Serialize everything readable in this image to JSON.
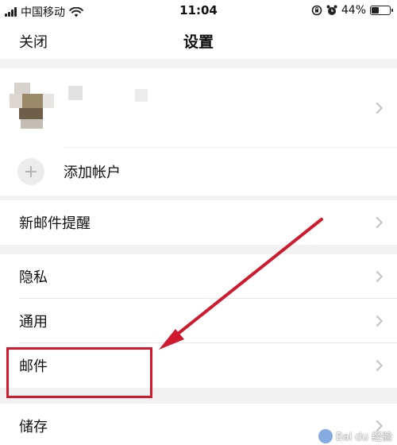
{
  "status_bar": {
    "carrier": "中国移动",
    "time": "11:04",
    "battery_text": "44%",
    "battery_level": 0.44,
    "icons": [
      "signal-icon",
      "wifi-icon",
      "rotation-lock-icon",
      "alarm-icon",
      "battery-icon"
    ]
  },
  "nav": {
    "close_label": "关闭",
    "title": "设置"
  },
  "account": {
    "add_account_label": "添加帐户"
  },
  "sections": {
    "notifications": {
      "new_mail_alert": "新邮件提醒"
    },
    "general": {
      "privacy": "隐私",
      "common": "通用",
      "mail": "邮件"
    },
    "storage": {
      "storage": "储存"
    }
  },
  "watermark": {
    "text": "Bai du 经验"
  },
  "colors": {
    "annotation_red": "#d0192f",
    "background": "#f2f2f2",
    "chevron": "#c4c4c4"
  }
}
